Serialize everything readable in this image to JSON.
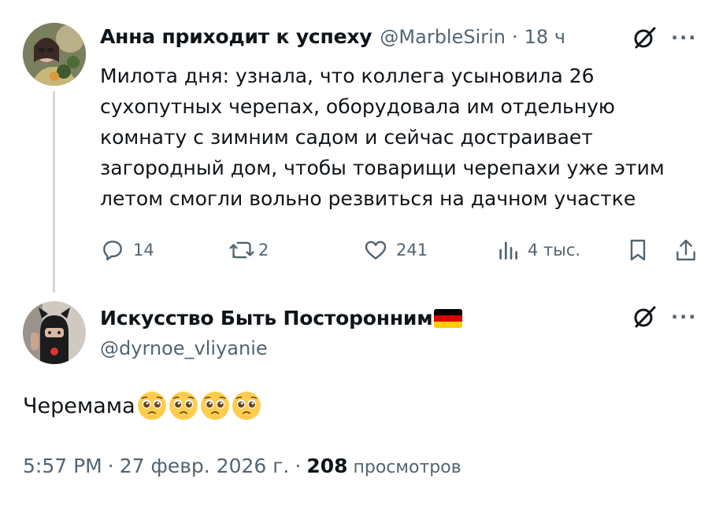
{
  "original": {
    "author_name": "Анна приходит к успеху",
    "handle": "@MarbleSirin",
    "separator": "·",
    "time_ago": "18 ч",
    "text": "Милота дня: узнала, что коллега усыновила 26 сухопутных черепах, оборудовала им отдельную комнату с зимним садом и сейчас достраивает загородный дом, чтобы товарищи черепахи уже этим летом смогли вольно резвиться на дачном участке",
    "actions": {
      "replies": "14",
      "reposts": "2",
      "likes": "241",
      "views": "4 тыс."
    },
    "more_label": "···"
  },
  "reply": {
    "author_name": "Искусство Быть Посторонним",
    "handle": "@dyrnoe_vliyanie",
    "text": "Черемама",
    "more_label": "···",
    "emoji_count": 4
  },
  "footer": {
    "time": "5:57 PM",
    "separator": "·",
    "date": "27 февр. 2026 г.",
    "separator2": "·",
    "views_count": "208",
    "views_label": "просмотров"
  },
  "colors": {
    "text": "#0f1419",
    "secondary": "#536471",
    "thread_line": "#cfd9de"
  }
}
